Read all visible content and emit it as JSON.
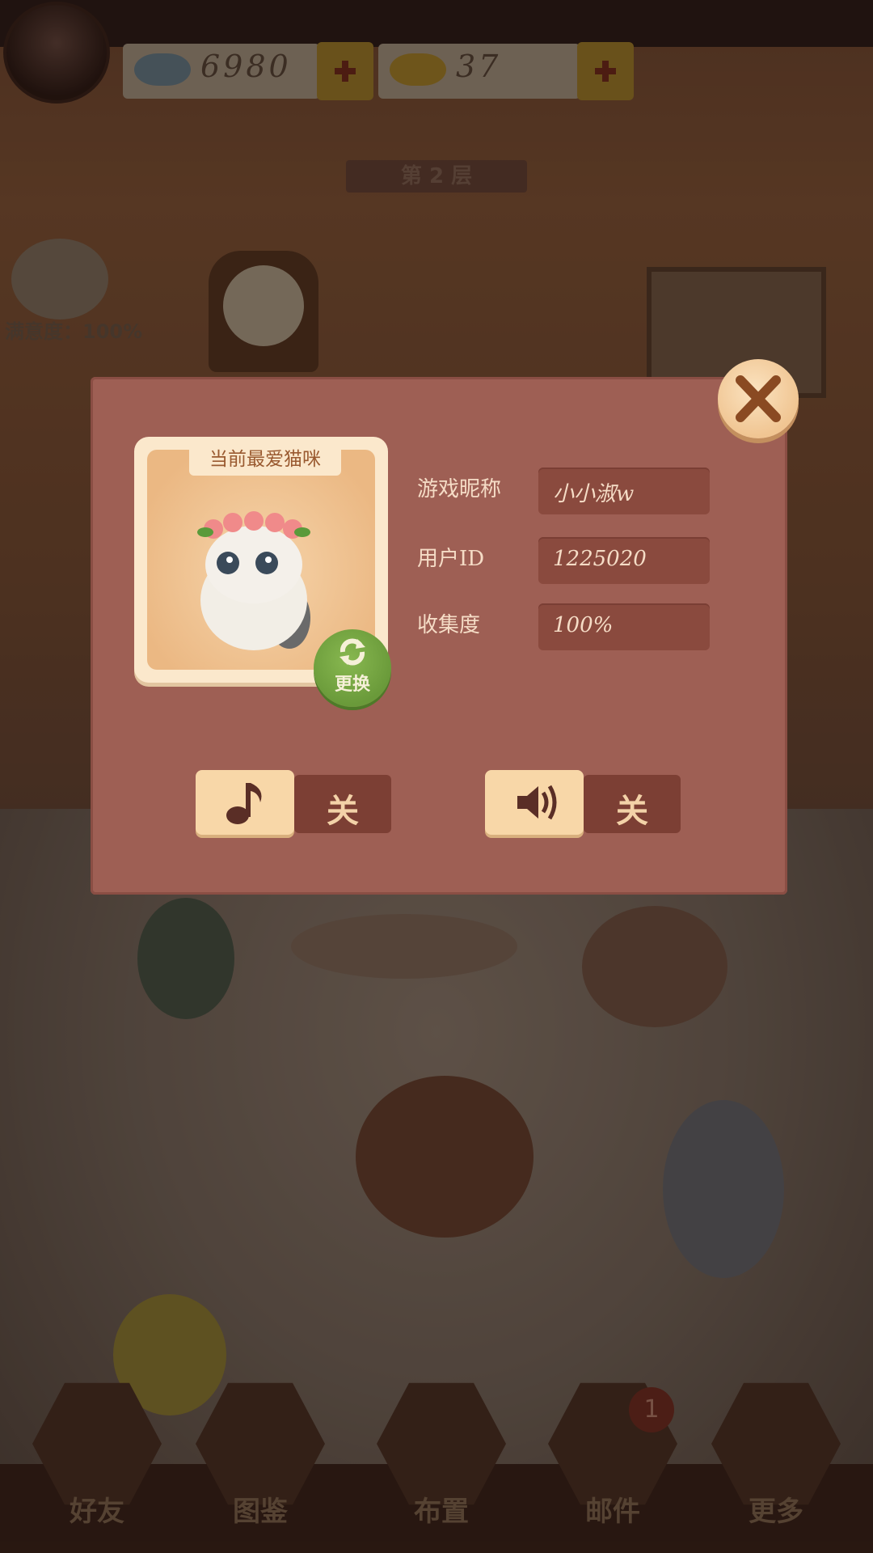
{
  "hud": {
    "fish_count": "6980",
    "gold_fish_count": "37",
    "floor_label": "第 2 层",
    "satisfaction": "满意度：100%"
  },
  "nav": {
    "items": [
      {
        "label": "好友",
        "icon": "friends-icon"
      },
      {
        "label": "图鉴",
        "icon": "book-icon"
      },
      {
        "label": "布置",
        "icon": "decor-icon"
      },
      {
        "label": "邮件",
        "icon": "mail-icon"
      },
      {
        "label": "更多",
        "icon": "more-icon"
      }
    ],
    "mail_badge": "1"
  },
  "dialog": {
    "favorite_cat_label": "当前最爱猫咪",
    "change_label": "更换",
    "fields": [
      {
        "label": "游戏昵称",
        "value": "小小淑w"
      },
      {
        "label": "用户ID",
        "value": "1225020"
      },
      {
        "label": "收集度",
        "value": "100%"
      }
    ],
    "music_toggle": {
      "icon": "music-note-icon",
      "state": "关"
    },
    "sound_toggle": {
      "icon": "speaker-icon",
      "state": "关"
    }
  },
  "colors": {
    "dialog_bg": "#9e5f54",
    "field_bg": "#8a4a3e",
    "toggle_on": "#f8d7a8",
    "change_green": "#6a9a3a"
  }
}
